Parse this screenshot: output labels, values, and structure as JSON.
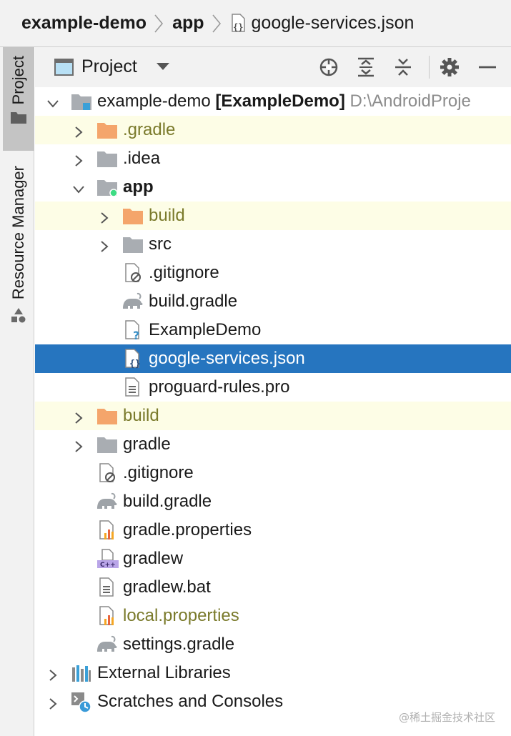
{
  "breadcrumb": {
    "items": [
      "example-demo",
      "app",
      "google-services.json"
    ]
  },
  "side_tabs": {
    "project": "Project",
    "resource_manager": "Resource Manager"
  },
  "panel": {
    "view_label": "Project",
    "toolbar_icons": [
      "locate-icon",
      "expand-all-icon",
      "collapse-all-icon",
      "gear-icon",
      "minimize-icon"
    ]
  },
  "tree": [
    {
      "name": "example-demo",
      "bold_part": "[ExampleDemo]",
      "path": "D:\\AndroidProje"
    },
    {
      "name": ".gradle"
    },
    {
      "name": ".idea"
    },
    {
      "name": "app"
    },
    {
      "name": "build"
    },
    {
      "name": "src"
    },
    {
      "name": ".gitignore"
    },
    {
      "name": "build.gradle"
    },
    {
      "name": "ExampleDemo"
    },
    {
      "name": "google-services.json"
    },
    {
      "name": "proguard-rules.pro"
    },
    {
      "name": "build"
    },
    {
      "name": "gradle"
    },
    {
      "name": ".gitignore"
    },
    {
      "name": "build.gradle"
    },
    {
      "name": "gradle.properties"
    },
    {
      "name": "gradlew"
    },
    {
      "name": "gradlew.bat"
    },
    {
      "name": "local.properties"
    },
    {
      "name": "settings.gradle"
    },
    {
      "name": "External Libraries"
    },
    {
      "name": "Scratches and Consoles"
    }
  ],
  "watermark": "@稀土掘金技术社区",
  "colors": {
    "selection": "#2675bf",
    "excluded_highlight": "#fdfde6",
    "excluded_text": "#7a7a2b",
    "excluded_folder": "#f4a56b",
    "folder": "#a9adb2"
  }
}
